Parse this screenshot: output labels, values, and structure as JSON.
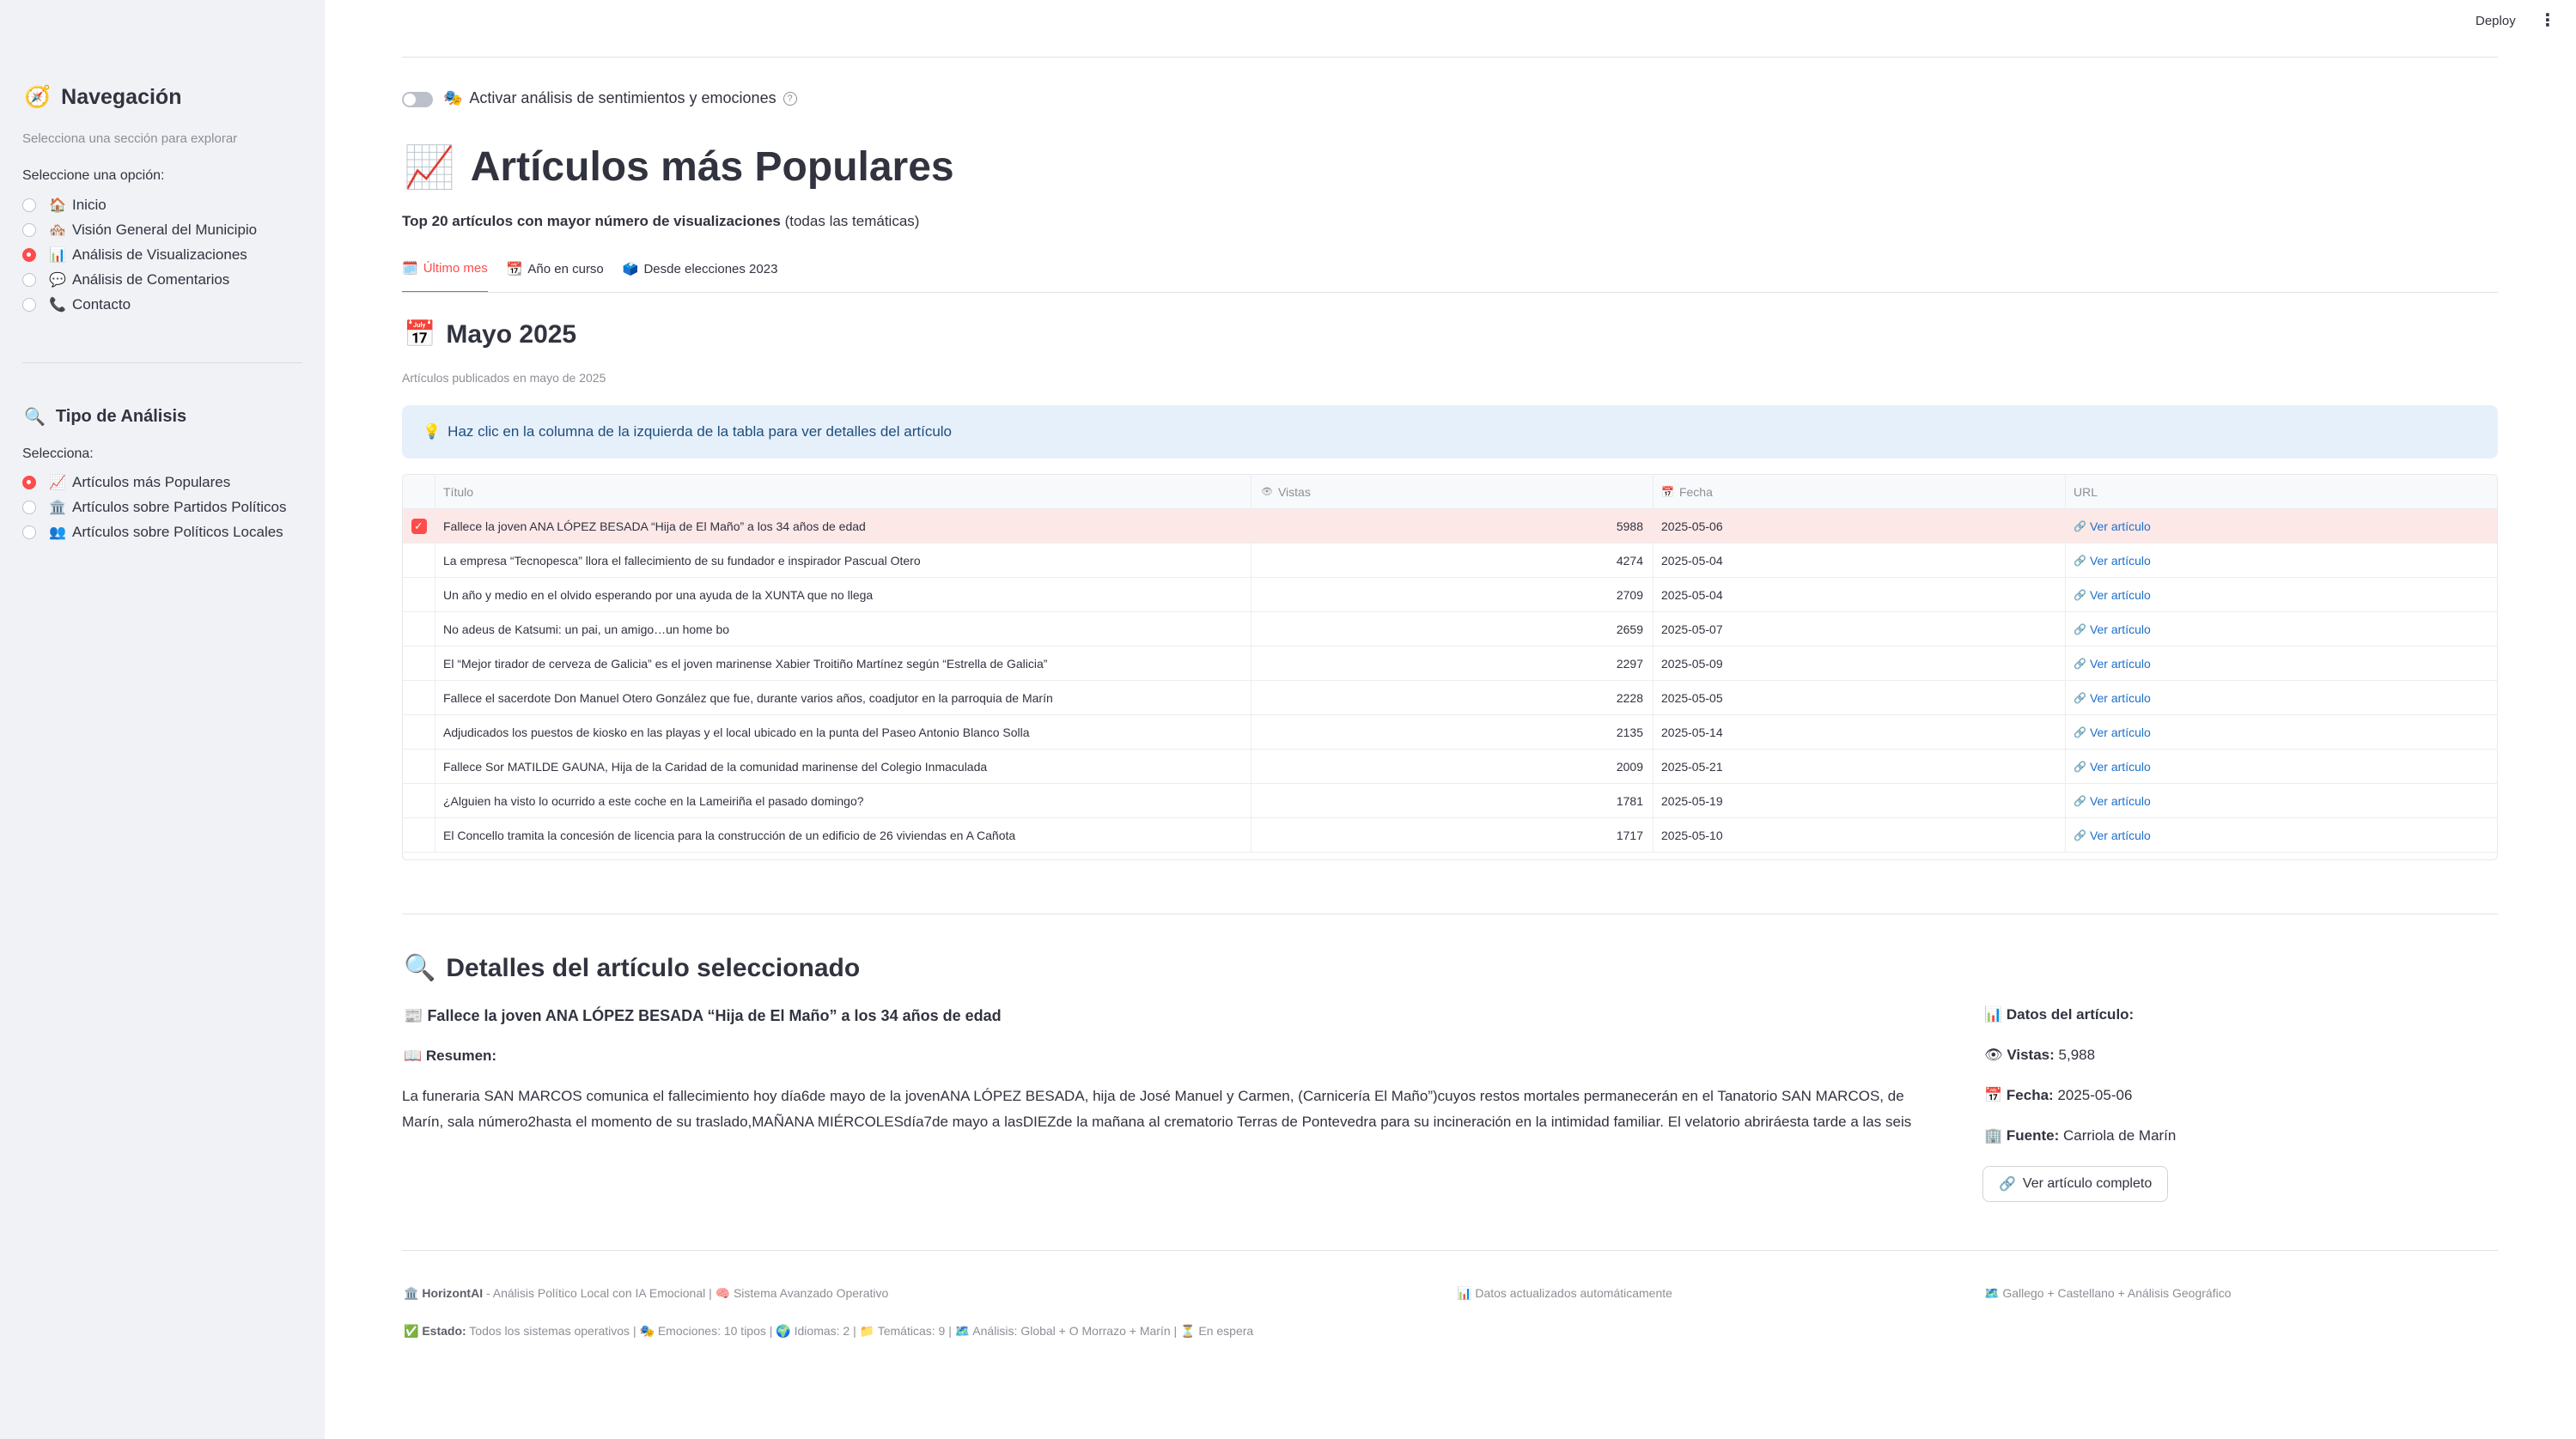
{
  "sidebar": {
    "nav_icon": "🧭",
    "nav_title": "Navegación",
    "nav_subtitle": "Selecciona una sección para explorar",
    "nav_select_label": "Seleccione una opción:",
    "nav_items": [
      {
        "icon": "🏠",
        "label": "Inicio",
        "selected": false
      },
      {
        "icon": "🏘️",
        "label": "Visión General del Municipio",
        "selected": false
      },
      {
        "icon": "📊",
        "label": "Análisis de Visualizaciones",
        "selected": true
      },
      {
        "icon": "💬",
        "label": "Análisis de Comentarios",
        "selected": false
      },
      {
        "icon": "📞",
        "label": "Contacto",
        "selected": false
      }
    ],
    "analysis_icon": "🔍",
    "analysis_title": "Tipo de Análisis",
    "analysis_select_label": "Selecciona:",
    "analysis_items": [
      {
        "icon": "📈",
        "label": "Artículos más Populares",
        "selected": true
      },
      {
        "icon": "🏛️",
        "label": "Artículos sobre Partidos Políticos",
        "selected": false
      },
      {
        "icon": "👥",
        "label": "Artículos sobre Políticos Locales",
        "selected": false
      }
    ]
  },
  "topbar": {
    "deploy_label": "Deploy",
    "menu_icon": "more-vert-icon"
  },
  "toggle": {
    "icon": "🎭",
    "label": "Activar análisis de sentimientos y emociones",
    "help_icon": "?",
    "on": false
  },
  "header": {
    "title_icon": "📈",
    "title": "Artículos más Populares",
    "subtitle_bold": "Top 20 artículos con mayor número de visualizaciones",
    "subtitle_rest": " (todas las temáticas)"
  },
  "tabs": [
    {
      "icon": "🗓️",
      "label": "Último mes",
      "active": true
    },
    {
      "icon": "📆",
      "label": "Año en curso",
      "active": false
    },
    {
      "icon": "🗳️",
      "label": "Desde elecciones 2023",
      "active": false
    }
  ],
  "month": {
    "icon": "📅",
    "title": "Mayo 2025",
    "caption": "Artículos publicados en mayo de 2025"
  },
  "info": {
    "icon": "💡",
    "text": "Haz clic en la columna de la izquierda de la tabla para ver detalles del artículo"
  },
  "table": {
    "headers": {
      "title": "Título",
      "views_icon": "👁",
      "views": "Vistas",
      "date_icon": "📅",
      "date": "Fecha",
      "url": "URL"
    },
    "link_icon": "🔗",
    "rows": [
      {
        "title": "Fallece la joven ANA LÓPEZ BESADA “Hija de El Maño” a los 34 años de edad",
        "views": "5988",
        "date": "2025-05-06",
        "url": "Ver artículo",
        "selected": true
      },
      {
        "title": "La empresa “Tecnopesca” llora el fallecimiento de su fundador e inspirador Pascual Otero",
        "views": "4274",
        "date": "2025-05-04",
        "url": "Ver artículo",
        "selected": false
      },
      {
        "title": "Un año y medio en el olvido esperando por una ayuda de la XUNTA que no llega",
        "views": "2709",
        "date": "2025-05-04",
        "url": "Ver artículo",
        "selected": false
      },
      {
        "title": "No adeus de Katsumi: un pai, un amigo…un home bo",
        "views": "2659",
        "date": "2025-05-07",
        "url": "Ver artículo",
        "selected": false
      },
      {
        "title": "El “Mejor tirador de cerveza de Galicia” es el joven marinense Xabier Troitiño Martínez según “Estrella de Galicia”",
        "views": "2297",
        "date": "2025-05-09",
        "url": "Ver artículo",
        "selected": false
      },
      {
        "title": "Fallece el sacerdote Don Manuel Otero González que fue, durante varios años, coadjutor en la parroquia de Marín",
        "views": "2228",
        "date": "2025-05-05",
        "url": "Ver artículo",
        "selected": false
      },
      {
        "title": "Adjudicados los puestos de kiosko en las playas y el local ubicado en la punta del Paseo Antonio Blanco Solla",
        "views": "2135",
        "date": "2025-05-14",
        "url": "Ver artículo",
        "selected": false
      },
      {
        "title": "Fallece Sor MATILDE GAUNA, Hija de la Caridad de la comunidad marinense del Colegio Inmaculada",
        "views": "2009",
        "date": "2025-05-21",
        "url": "Ver artículo",
        "selected": false
      },
      {
        "title": "¿Alguien ha visto lo ocurrido a este coche en la Lameiriña el pasado domingo?",
        "views": "1781",
        "date": "2025-05-19",
        "url": "Ver artículo",
        "selected": false
      },
      {
        "title": "El Concello tramita la concesión de licencia para la construcción de un edificio de 26 viviendas en A Cañota",
        "views": "1717",
        "date": "2025-05-10",
        "url": "Ver artículo",
        "selected": false
      }
    ]
  },
  "details": {
    "icon": "🔍",
    "title": "Detalles del artículo seleccionado",
    "article_icon": "📰",
    "article_title": "Fallece la joven ANA LÓPEZ BESADA “Hija de El Maño” a los 34 años de edad",
    "summary_icon": "📖",
    "summary_label": "Resumen:",
    "summary_text": "La funeraria SAN MARCOS comunica el fallecimiento hoy día6de mayo de la jovenANA LÓPEZ BESADA, hija de José Manuel y Carmen, (Carnicería El Maño”)cuyos restos mortales permanecerán en el Tanatorio SAN MARCOS, de Marín, sala número2hasta el momento de su traslado,MAÑANA MIÉRCOLESdía7de mayo a lasDIEZde la mañana al crematorio Terras de Pontevedra para su incineración en la intimidad familiar. El velatorio abriráesta tarde a las seis",
    "data_icon": "📊",
    "data_label": "Datos del artículo:",
    "views_icon": "👁",
    "views_label": "Vistas:",
    "views_value": "5,988",
    "date_icon": "📅",
    "date_label": "Fecha:",
    "date_value": "2025-05-06",
    "source_icon": "🏢",
    "source_label": "Fuente:",
    "source_value": "Carriola de Marín",
    "button_icon": "🔗",
    "button_label": "Ver artículo completo"
  },
  "footer": {
    "brand_icon": "🏛️",
    "brand": "HorizontAI",
    "brand_rest": " - Análisis Político Local con IA Emocional | ",
    "brain_icon": "🧠",
    "system_text": "Sistema Avanzado Operativo",
    "updated_icon": "📊",
    "updated_text": "Datos actualizados automáticamente",
    "langs_icon": "🗺️",
    "langs_text": "Gallego + Castellano + Análisis Geográfico",
    "status_icon": "✅",
    "status_label": "Estado:",
    "status_text": " Todos los sistemas operativos | ",
    "emo_icon": "🎭",
    "emo_text": "Emociones: 10 tipos | ",
    "lang_icon": "🌍",
    "lang_text": "Idiomas: 2 | ",
    "topic_icon": "📁",
    "topic_text": "Temáticas: 9 | ",
    "scope_icon": "🗺️",
    "scope_text": "Análisis: Global + O Morrazo + Marín | ",
    "wait_icon": "⏳",
    "wait_text": "En espera"
  }
}
